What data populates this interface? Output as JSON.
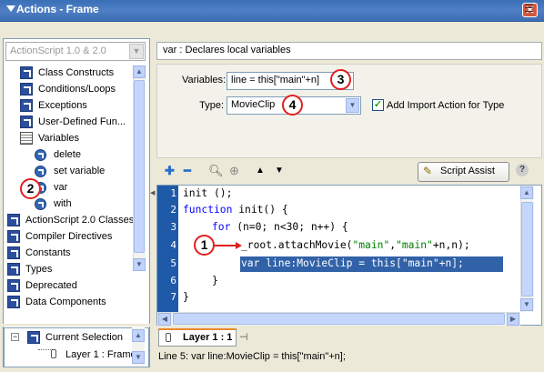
{
  "window": {
    "title": "Actions - Frame",
    "close_glyph": "✕"
  },
  "toolbox": {
    "version_select": "ActionScript 1.0 & 2.0",
    "items": [
      {
        "label": "Class Constructs",
        "icon": "book-icon"
      },
      {
        "label": "Conditions/Loops",
        "icon": "book-icon"
      },
      {
        "label": "Exceptions",
        "icon": "book-icon"
      },
      {
        "label": "User-Defined Fun...",
        "icon": "book-icon"
      },
      {
        "label": "Variables",
        "icon": "open-book-icon"
      },
      {
        "label": "delete",
        "icon": "action-icon"
      },
      {
        "label": "set variable",
        "icon": "action-icon"
      },
      {
        "label": "var",
        "icon": "action-icon"
      },
      {
        "label": "with",
        "icon": "action-icon"
      },
      {
        "label": "ActionScript 2.0 Classes",
        "icon": "book-icon"
      },
      {
        "label": "Compiler Directives",
        "icon": "book-icon"
      },
      {
        "label": "Constants",
        "icon": "book-icon"
      },
      {
        "label": "Types",
        "icon": "book-icon"
      },
      {
        "label": "Deprecated",
        "icon": "book-icon"
      },
      {
        "label": "Data Components",
        "icon": "book-icon"
      }
    ]
  },
  "selection_panel": {
    "items": [
      {
        "label": "Current Selection"
      },
      {
        "label": "Layer 1 : Frame"
      }
    ]
  },
  "description": "var : Declares local variables",
  "properties": {
    "variables_label": "Variables:",
    "variables_value": "line = this[\"main\"+n]",
    "type_label": "Type:",
    "type_value": "MovieClip",
    "checkbox_label": "Add Import Action for Type",
    "checkbox_checked": true
  },
  "toolbar": {
    "script_assist_label": "Script Assist",
    "help_glyph": "?"
  },
  "callouts": {
    "c1": "1",
    "c2": "2",
    "c3": "3",
    "c4": "4"
  },
  "code": {
    "line_numbers": [
      "1",
      "2",
      "3",
      "4",
      "5",
      "6",
      "7"
    ],
    "l1": "init ();",
    "l2_kw": "function",
    "l2_rest": " init() {",
    "l3_kw": "for",
    "l3_rest": " (n=0; n<30; n++) {",
    "l4_a": "_root.attachMovie(",
    "l4_s1": "\"main\"",
    "l4_b": ",",
    "l4_s2": "\"main\"",
    "l4_c": "+n,n);",
    "l5": "var line:MovieClip = this[\"main\"+n];",
    "l6": "}",
    "l7": "}"
  },
  "tabs": {
    "layer_tab": "Layer 1 : 1"
  },
  "status": "Line 5: var line:MovieClip = this[\"main\"+n];"
}
